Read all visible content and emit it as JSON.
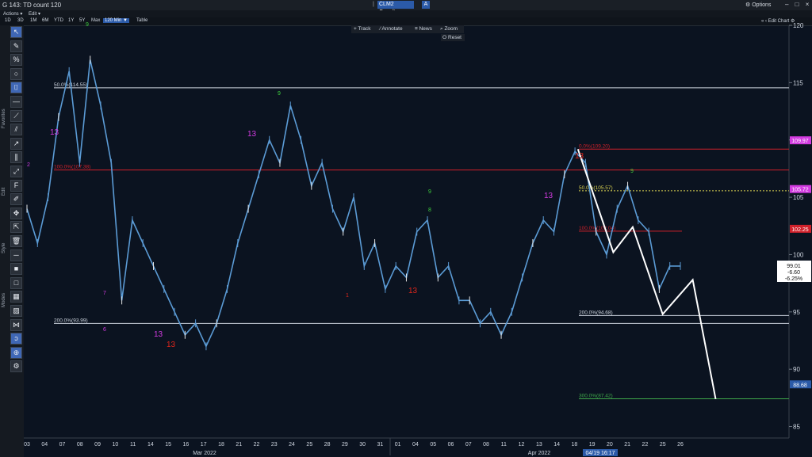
{
  "window": {
    "title": "G 143: TD count 120",
    "options_label": "Options",
    "win_buttons": "– □ ×"
  },
  "ticker": {
    "symbol": "CLM2 Comdty",
    "separator": "|",
    "a_label": "A"
  },
  "actions": {
    "actions_label": "Actions ▾",
    "edit_label": "Edit ▾"
  },
  "ranges": {
    "items": [
      "1D",
      "3D",
      "1M",
      "6M",
      "YTD",
      "1Y",
      "5Y",
      "Max"
    ],
    "selected": "120 Min ▼",
    "table_label": "Table"
  },
  "edit_chart_label": "« ‹ Edit Chart ⚙",
  "toolbar_top": {
    "track": "+ Track",
    "annotate": "⁄ Annotate",
    "news": "≡ News",
    "zoom": "⌕ Zoom",
    "reset": "⭘ Reset"
  },
  "side_labels": {
    "favorites": "Favorites",
    "edit": "Edit",
    "style": "Style",
    "modes": "Modes"
  },
  "tools": [
    "cursor-icon",
    "pencil-icon",
    "percent-icon",
    "circle-icon",
    "tall-bracket-icon",
    "line-icon",
    "ray-icon",
    "channel-icon",
    "arrow-line-icon",
    "parallel-icon",
    "trend-icon",
    "fib-icon",
    "draw-icon",
    "move-icon",
    "cursor-select-icon",
    "trash-icon",
    "style-line-icon",
    "square-icon",
    "square2-icon",
    "grid-icon",
    "hatch-icon",
    "node-icon",
    "curve-icon",
    "crosshair-icon",
    "settings-icon"
  ],
  "colors": {
    "price": "#5b9bd5",
    "candle_alt": "#e6e6e6",
    "td_green": "#3ecf3e",
    "td_magenta": "#d23be0",
    "td_red": "#e0261b",
    "fib_red": "#d0202a",
    "yellow_line": "#d8d050",
    "green_line": "#3ea84a",
    "white_path": "#ffffff"
  },
  "chart_data": {
    "type": "line",
    "title": "",
    "xlabel": "",
    "ylabel": "",
    "ylim": [
      84,
      120
    ],
    "y_ticks": [
      85,
      90,
      95,
      100,
      105,
      110,
      115,
      120
    ],
    "x_tick_labels": [
      "03",
      "04",
      "07",
      "08",
      "09",
      "10",
      "11",
      "14",
      "15",
      "16",
      "17",
      "18",
      "21",
      "22",
      "23",
      "24",
      "25",
      "28",
      "29",
      "30",
      "31",
      "01",
      "04",
      "05",
      "06",
      "07",
      "08",
      "11",
      "12",
      "13",
      "14",
      "18",
      "19",
      "20",
      "21",
      "22",
      "25",
      "26"
    ],
    "x_month_labels": [
      "Mar 2022",
      "Apr 2022"
    ],
    "x_cursor_label": "04/19 16:17",
    "series": [
      {
        "name": "CLM2 Comdty 120 Min",
        "values": [
          104,
          101,
          105,
          112,
          116,
          108,
          117,
          113,
          108,
          96,
          103,
          101,
          99,
          97,
          95,
          93,
          94,
          92,
          94,
          97,
          101,
          104,
          107,
          110,
          108,
          113,
          110,
          106,
          108,
          104,
          102,
          105,
          99,
          101,
          97,
          99,
          98,
          102,
          103,
          98,
          99,
          96,
          96,
          94,
          95,
          93,
          95,
          98,
          101,
          103,
          102,
          107,
          109,
          108,
          102,
          100,
          104,
          106,
          103,
          102,
          97,
          99,
          99
        ]
      }
    ],
    "price_labels": [
      {
        "value": "109.97",
        "y": 109.97,
        "color": "#d23be0"
      },
      {
        "value": "105.72",
        "y": 105.72,
        "color": "#d23be0"
      },
      {
        "value": "102.25",
        "y": 102.25,
        "color": "#d0202a"
      },
      {
        "value": "88.68",
        "y": 88.68,
        "color": "#2b5aa8"
      }
    ],
    "last_price_box": [
      "99.01",
      "-6.60",
      "-6.25%"
    ],
    "fib_levels": [
      {
        "label": "0.0%(109.20)",
        "y": 109.2,
        "color": "#d0202a"
      },
      {
        "label": "50.0%(105.57)",
        "y": 105.57,
        "color": "#d8d050"
      },
      {
        "label": "100.0%(102.04)",
        "y": 102.04,
        "color": "#d0202a"
      },
      {
        "label": "200.0%(94.68)",
        "y": 94.68,
        "color": "#cfd6e0"
      },
      {
        "label": "300.0%(87.42)",
        "y": 87.42,
        "color": "#3ea84a"
      },
      {
        "label": "100.0%(107.38)",
        "y": 107.38,
        "color": "#d0202a"
      },
      {
        "label": "200.0%(93.99)",
        "y": 93.99,
        "color": "#cfd6e0"
      },
      {
        "label": "50.0%(114.55)",
        "y": 114.55,
        "color": "#cfd6e0"
      }
    ],
    "forecast_path": [
      {
        "x": "19",
        "y": 109.2
      },
      {
        "x": "21",
        "y": 100.2
      },
      {
        "x": "22",
        "y": 102.4
      },
      {
        "x": "25",
        "y": 94.8
      },
      {
        "x": "26.5",
        "y": 97.8
      },
      {
        "x": "28",
        "y": 87.4
      }
    ],
    "td_labels": [
      "13",
      "13",
      "13",
      "13",
      "13",
      "13",
      "13",
      "9",
      "9",
      "9",
      "9",
      "8",
      "7",
      "6",
      "2",
      "1"
    ]
  }
}
